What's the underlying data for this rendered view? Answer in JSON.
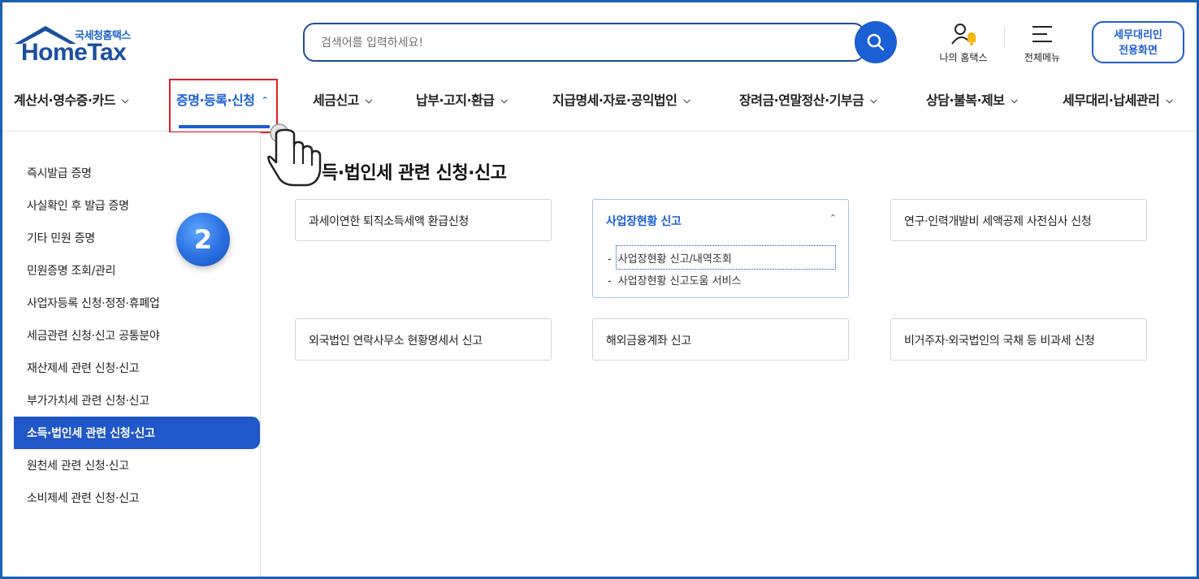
{
  "header": {
    "logo_sub": "국세청홈택스",
    "logo_main": "HomeTax",
    "search_placeholder": "검색어를 입력하세요!",
    "my_hometax_label": "나의 홈택스",
    "all_menu_label": "전체메뉴",
    "proxy_button_line1": "세무대리인",
    "proxy_button_line2": "전용화면",
    "icons": [
      "search-icon",
      "user-bell-icon",
      "hamburger-icon"
    ],
    "accent_color": "#1a5fd4"
  },
  "nav": {
    "items": [
      {
        "label": "계산서·영수증·카드",
        "active": false
      },
      {
        "label": "증명·등록·신청",
        "active": true
      },
      {
        "label": "세금신고",
        "active": false
      },
      {
        "label": "납부·고지·환급",
        "active": false
      },
      {
        "label": "지급명세·자료·공익법인",
        "active": false
      },
      {
        "label": "장려금·연말정산·기부금",
        "active": false
      },
      {
        "label": "상담·불복·제보",
        "active": false
      },
      {
        "label": "세무대리·납세관리",
        "active": false
      }
    ]
  },
  "sidebar": {
    "items": [
      {
        "label": "즉시발급 증명"
      },
      {
        "label": "사실확인 후 발급 증명"
      },
      {
        "label": "기타 민원 증명"
      },
      {
        "label": "민원증명 조회/관리"
      },
      {
        "label": "사업자등록 신청·정정·휴폐업"
      },
      {
        "label": "세금관련 신청·신고 공통분야"
      },
      {
        "label": "재산제세 관련 신청·신고"
      },
      {
        "label": "부가가치세 관련 신청·신고"
      },
      {
        "label": "소득·법인세 관련 신청·신고"
      },
      {
        "label": "원천세 관련 신청·신고"
      },
      {
        "label": "소비제세 관련 신청·신고"
      }
    ],
    "active_index": 8
  },
  "step_badge": "2",
  "main": {
    "section_title": "득·법인세 관련 신청·신고",
    "cards": [
      {
        "label": "과세이연한 퇴직소득세액 환급신청"
      },
      {
        "label": "사업장현황 신고",
        "open": true,
        "sub_items": [
          "사업장현황 신고/내역조회",
          "사업장현황 신고도움 서비스"
        ]
      },
      {
        "label": "연구·인력개발비 세액공제 사전심사 신청"
      },
      {
        "label": "외국법인 연락사무소 현황명세서 신고"
      },
      {
        "label": "해외금융계좌 신고"
      },
      {
        "label": "비거주자·외국법인의 국채 등 비과세 신청"
      }
    ],
    "dash": "-"
  }
}
